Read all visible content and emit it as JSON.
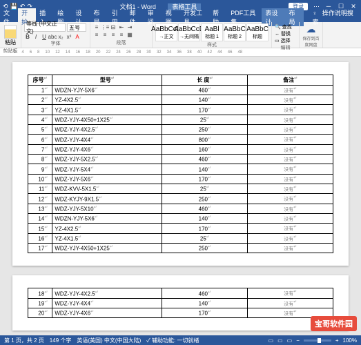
{
  "titlebar": {
    "doc_title": "文档1 - Word",
    "context_tab": "表格工具",
    "login": "登录"
  },
  "menu": {
    "file": "文件",
    "home": "开始",
    "insert": "插入",
    "draw": "绘图",
    "design": "设计",
    "layout": "布局",
    "references": "引用",
    "mailings": "邮件",
    "review": "审阅",
    "view": "视图",
    "developer": "开发工具",
    "help": "帮助",
    "pdf": "PDF工具集",
    "tbl_design": "表设计",
    "tbl_layout": "布局",
    "tell": "操作说明搜索"
  },
  "ribbon": {
    "clipboard": "剪贴板",
    "paste": "粘贴",
    "font_group": "字体",
    "font_name": "等线 (中文正文)",
    "font_size": "五号",
    "para_group": "段落",
    "styles_group": "样式",
    "editing_group": "编辑",
    "find": "查找",
    "replace": "替换",
    "select": "选择",
    "save_group": "保存",
    "save_baidu": "保存到百度网盘",
    "styles": [
      {
        "sample": "AaBbCcD",
        "name": "→正文"
      },
      {
        "sample": "AaBbCcD",
        "name": "→无间隔"
      },
      {
        "sample": "AaBl",
        "name": "标题 1"
      },
      {
        "sample": "AaBbC",
        "name": "标题 2"
      },
      {
        "sample": "AaBbC",
        "name": "标题"
      }
    ]
  },
  "table": {
    "headers": [
      "序号",
      "型号",
      "长 度",
      "备注"
    ],
    "rows": [
      {
        "n": "1",
        "model": "WDZN-YJY-5X6",
        "len": "460",
        "note": "没有"
      },
      {
        "n": "2",
        "model": "YZ-4X2.5",
        "len": "140",
        "note": "没有"
      },
      {
        "n": "3",
        "model": "YZ-4X1.5",
        "len": "170",
        "note": "没有"
      },
      {
        "n": "4",
        "model": "WDZ-YJY-4X50+1X25",
        "len": "25",
        "note": "没有"
      },
      {
        "n": "5",
        "model": "WDZ-YJY-4X2.5",
        "len": "250",
        "note": "没有"
      },
      {
        "n": "6",
        "model": "WDZ-YJY-4X4",
        "len": "800",
        "note": "没有"
      },
      {
        "n": "7",
        "model": "WDZ-YJY-4X6",
        "len": "160",
        "note": "没有"
      },
      {
        "n": "8",
        "model": "WDZ-YJY-5X2.5",
        "len": "460",
        "note": "没有"
      },
      {
        "n": "9",
        "model": "WDZ-YJY-5X4",
        "len": "140",
        "note": "没有"
      },
      {
        "n": "10",
        "model": "WDZ-YJY-5X6",
        "len": "170",
        "note": "没有"
      },
      {
        "n": "11",
        "model": "WDZ-KVV-5X1.5",
        "len": "25",
        "note": "没有"
      },
      {
        "n": "12",
        "model": "WDZ-KYJY-9X1.5",
        "len": "250",
        "note": "没有"
      },
      {
        "n": "13",
        "model": "WDZ-YJY-5X10",
        "len": "460",
        "note": "没有"
      },
      {
        "n": "14",
        "model": "WDZN-YJY-5X6",
        "len": "140",
        "note": "没有"
      },
      {
        "n": "15",
        "model": "YZ-4X2.5",
        "len": "170",
        "note": "没有"
      },
      {
        "n": "16",
        "model": "YZ-4X1.5",
        "len": "25",
        "note": "没有"
      },
      {
        "n": "17",
        "model": "WDZ-YJY-4X50+1X25",
        "len": "250",
        "note": "没有"
      }
    ],
    "rows2": [
      {
        "n": "18",
        "model": "WDZ-YJY-4X2.5",
        "len": "460",
        "note": "没有"
      },
      {
        "n": "19",
        "model": "WDZ-YJY-4X4",
        "len": "140",
        "note": "没有"
      },
      {
        "n": "20",
        "model": "WDZ-YJY-4X6",
        "len": "170",
        "note": "没有"
      }
    ]
  },
  "status": {
    "page": "第 1 页，共 2 页",
    "words": "149 个字",
    "lang": "英语(美国) 中文(中国大陆)",
    "access": "辅助功能: 一切就绪",
    "zoom": "100%"
  },
  "watermark": "宝哥软件园"
}
